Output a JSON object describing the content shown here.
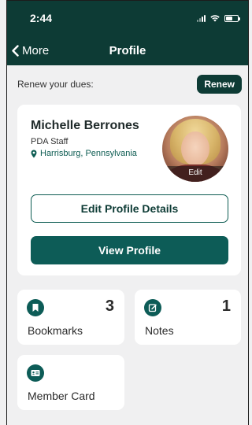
{
  "status_bar": {
    "time": "2:44"
  },
  "nav": {
    "back_label": "More",
    "title": "Profile"
  },
  "dues": {
    "label": "Renew your dues:",
    "button_label": "Renew"
  },
  "profile": {
    "name": "Michelle Berrones",
    "role": "PDA Staff",
    "location": "Harrisburg, Pennsylvania",
    "avatar_edit_label": "Edit",
    "edit_button_label": "Edit Profile Details",
    "view_button_label": "View Profile"
  },
  "tiles": [
    {
      "label": "Bookmarks",
      "count": "3",
      "icon": "bookmark-icon"
    },
    {
      "label": "Notes",
      "count": "1",
      "icon": "edit-note-icon"
    },
    {
      "label": "Member Card",
      "icon": "id-card-icon"
    }
  ],
  "colors": {
    "header_bg": "#0d3b35",
    "accent": "#0d5c57",
    "background": "#f0f0f1",
    "card": "#ffffff"
  }
}
